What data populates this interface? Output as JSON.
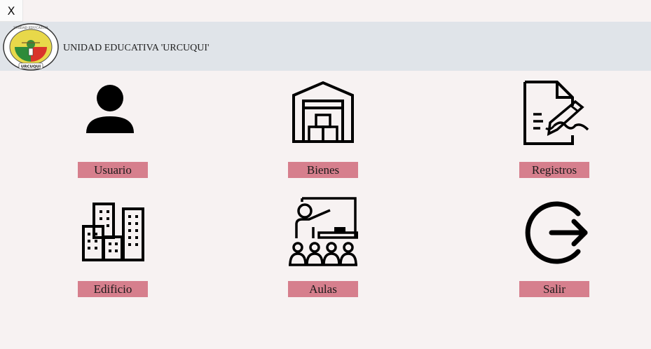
{
  "window": {
    "close_label": "X"
  },
  "header": {
    "school_name": "UNIDAD EDUCATIVA 'URCUQUI'",
    "logo": {
      "top_text": "UNIDAD EDUCATIVA",
      "bottom_text": "URCUQUI"
    }
  },
  "menu": {
    "usuario": {
      "label": "Usuario",
      "icon": "user-icon"
    },
    "bienes": {
      "label": "Bienes",
      "icon": "warehouse-icon"
    },
    "registros": {
      "label": "Registros",
      "icon": "document-sign-icon"
    },
    "edificio": {
      "label": "Edificio",
      "icon": "buildings-icon"
    },
    "aulas": {
      "label": "Aulas",
      "icon": "classroom-icon"
    },
    "salir": {
      "label": "Salir",
      "icon": "logout-icon"
    }
  },
  "colors": {
    "label_bg": "#d67f8d",
    "header_bg": "#e0e4e9",
    "page_bg": "#f7f2f2"
  }
}
